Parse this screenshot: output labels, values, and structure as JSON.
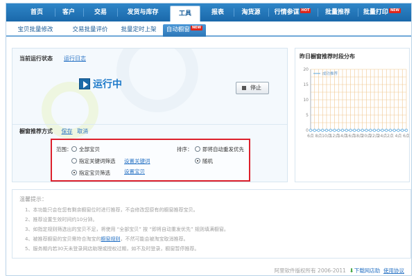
{
  "main_nav": {
    "tabs": [
      "首页",
      "客户",
      "交易",
      "发货与库存",
      "工具",
      "报表",
      "淘货源",
      "行情参谋",
      "批量推荐",
      "批量打印"
    ],
    "active": "工具",
    "hot_label": "HOT",
    "new_label": "NEW"
  },
  "sub_nav": {
    "tabs": [
      "宝贝批量修改",
      "交易批量评价",
      "批量定时上架",
      "自动橱窗"
    ],
    "active": "自动橱窗",
    "new_label": "NEW"
  },
  "status": {
    "label": "当前运行状态",
    "log_link": "运行日志",
    "state": "运行中",
    "stop_button": "停止"
  },
  "recommend_mode": {
    "label": "橱窗推荐方式",
    "save": "保存",
    "cancel": "取消"
  },
  "scope": {
    "label": "范围：",
    "options": [
      "全部宝贝",
      "指定关键词筛选",
      "指定宝贝筛选"
    ],
    "selected": "指定宝贝筛选",
    "set_keyword": "设置关键词",
    "set_item": "设置宝贝"
  },
  "sort": {
    "label": "排序：",
    "options": [
      "即将自动重发优先",
      "随机"
    ],
    "selected": "随机"
  },
  "chart_panel": {
    "title": "昨日橱窗推荐时段分布"
  },
  "chart_data": {
    "type": "line",
    "categories": [
      "6点",
      "8点",
      "10点",
      "12点",
      "14点",
      "16点",
      "18点",
      "20点",
      "22点",
      "24点",
      "2点",
      "4点",
      "6点"
    ],
    "ylim": [
      0,
      20
    ],
    "yticks": [
      0,
      5,
      10,
      15,
      20
    ],
    "series": [
      {
        "name": "成功推荐",
        "values": [
          0,
          0,
          0,
          0,
          0,
          0,
          0,
          0,
          0,
          0,
          0,
          0,
          0,
          0,
          0,
          0,
          0,
          0,
          0,
          0,
          0,
          0,
          0,
          0,
          0
        ]
      }
    ],
    "grid": true,
    "legend": "top-left",
    "colors": {
      "line": "#5aa7dc",
      "grid": "#f0c790",
      "axis": "#9aa9b6"
    }
  },
  "tips": {
    "heading": "温馨提示：",
    "lines": [
      {
        "pre": "1、本功能只会在您有剩余橱窗位时进行推荐，不会修改您原有的橱窗推荐宝贝。",
        "link": "",
        "post": ""
      },
      {
        "pre": "2、推荐设置生效时间约10分钟。",
        "link": "",
        "post": ""
      },
      {
        "pre": "3、如指定规则筛选出的宝贝不足，将使用 “全部宝贝” 按 “即将自动重发优先” 规则填满橱窗。",
        "link": "",
        "post": ""
      },
      {
        "pre": "4、被推荐橱窗的宝贝需符合淘宝的",
        "link": "橱窗规则",
        "post": "，不然可能会被淘宝取消推荐。"
      },
      {
        "pre": "5、服务期内若30天未登录网店助理或授权过期，如不及时登录，橱窗暂停推荐。",
        "link": "",
        "post": ""
      }
    ]
  },
  "footer": {
    "copyright": "阿里软件版权所有   2006-2011",
    "download": "下载网店助",
    "terms": "使用协议"
  }
}
